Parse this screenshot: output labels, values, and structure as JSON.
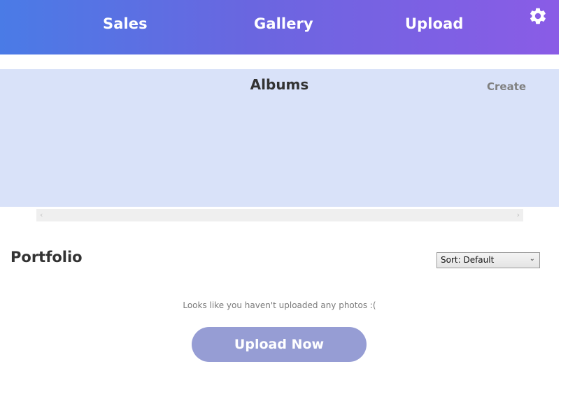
{
  "nav": {
    "items": [
      {
        "label": "Sales"
      },
      {
        "label": "Gallery"
      },
      {
        "label": "Upload"
      }
    ],
    "settings_icon": "gear-icon"
  },
  "albums": {
    "title": "Albums",
    "create_label": "Create"
  },
  "scrollbar": {
    "left_arrow": "‹",
    "right_arrow": "›"
  },
  "portfolio": {
    "title": "Portfolio",
    "sort": {
      "selected": "Sort: Default",
      "chevron": "⌄"
    },
    "empty_message": "Looks like you haven't uploaded any photos :(",
    "upload_button_label": "Upload Now"
  },
  "colors": {
    "header_gradient_start": "#4a7be6",
    "header_gradient_end": "#8a5ce6",
    "albums_bg": "#d9e2f9",
    "upload_button": "#969dd4"
  }
}
